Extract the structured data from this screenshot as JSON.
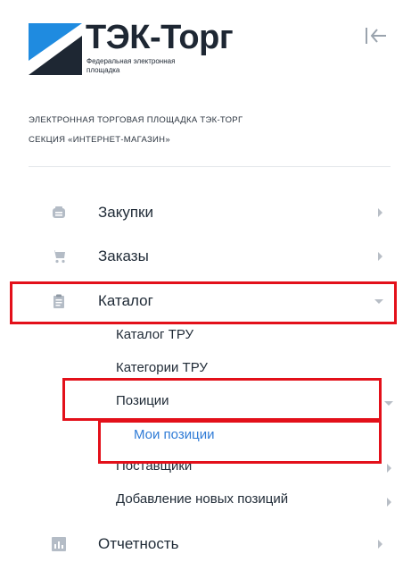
{
  "brand": {
    "name": "ТЭК-Торг",
    "tagline_line1": "Федеральная электронная",
    "tagline_line2": "площадка"
  },
  "subtitle": {
    "line1": "ЭЛЕКТРОННАЯ ТОРГОВАЯ ПЛОЩАДКА ТЭК-ТОРГ",
    "line2": "СЕКЦИЯ «ИНТЕРНЕТ-МАГАЗИН»"
  },
  "menu": {
    "purchases": "Закупки",
    "orders": "Заказы",
    "catalog": "Каталог",
    "catalog_tru": "Каталог ТРУ",
    "categories_tru": "Категории ТРУ",
    "positions": "Позиции",
    "my_positions": "Мои позиции",
    "suppliers": "Поставщики",
    "add_positions": "Добавление новых позиций",
    "reports": "Отчетность"
  },
  "colors": {
    "brand_blue": "#1f8be0",
    "text": "#1f2a36",
    "active": "#2f7bd6",
    "highlight": "#e3101a",
    "icon": "#b4bcc6"
  }
}
